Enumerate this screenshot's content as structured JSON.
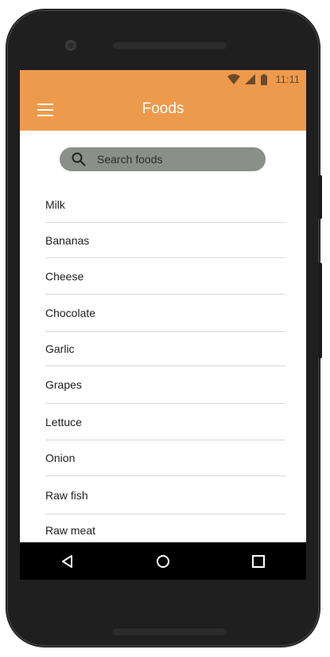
{
  "status_bar": {
    "time": "11:11",
    "icons": [
      "wifi-icon",
      "signal-icon",
      "battery-icon"
    ]
  },
  "app_bar": {
    "title": "Foods",
    "menu_icon": "menu-icon"
  },
  "search": {
    "placeholder": "Search foods",
    "icon": "search-icon"
  },
  "food_list": [
    "Milk",
    "Bananas",
    "Cheese",
    "Chocolate",
    "Garlic",
    "Grapes",
    "Lettuce",
    "Onion",
    "Raw fish",
    "Raw meat"
  ],
  "nav_bar": {
    "buttons": [
      "back-icon",
      "home-icon",
      "recents-icon"
    ]
  },
  "colors": {
    "accent": "#ee9a4d",
    "search_bg": "#8a8f89",
    "nav_bg": "#000000",
    "device": "#1f1f1f"
  }
}
